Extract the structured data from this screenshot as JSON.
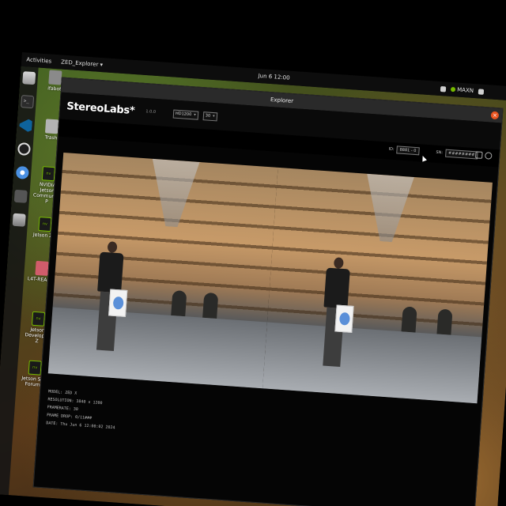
{
  "topbar": {
    "activities": "Activities",
    "app_menu": "ZED_Explorer ▾",
    "clock": "Jun 6 12:00",
    "gpu_label": "MAXN"
  },
  "desktop_icons": [
    {
      "label": "ifabot"
    },
    {
      "label": "Trash"
    },
    {
      "label": "NVIDIA Jetson Community P"
    },
    {
      "label": "Jetson Ze"
    },
    {
      "label": "L4T-READM"
    },
    {
      "label": "Jetson Developer Z"
    },
    {
      "label": "Jetson Sup Forums"
    }
  ],
  "window": {
    "title": "Explorer",
    "brand": "StereoLabs*",
    "version": "1.0.0",
    "resolution_select": "HD1200",
    "fps_select": "30"
  },
  "controls": {
    "id_label": "ID:",
    "id_value": "8881 - 0",
    "sn_label": "SN:",
    "sn_value": "########"
  },
  "camera_info": {
    "model": "MODEL: ZED X",
    "resolution": "RESOLUTION: 3840 x 1200",
    "framerate": "FRAMERATE: 30",
    "frame_drop": "FRAME DROP: 0/11###",
    "date": "DATE: Thu Jun 6 12:00:02 2024"
  }
}
